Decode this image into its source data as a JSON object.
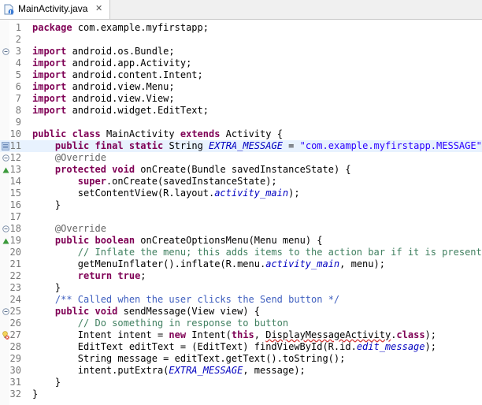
{
  "editor_tab": {
    "title": "MainActivity.java",
    "close_glyph": "✕"
  },
  "line_numbers": [
    "1",
    "2",
    "3",
    "4",
    "5",
    "6",
    "7",
    "8",
    "9",
    "10",
    "11",
    "12",
    "13",
    "14",
    "15",
    "16",
    "17",
    "18",
    "19",
    "20",
    "21",
    "22",
    "23",
    "24",
    "25",
    "26",
    "27",
    "28",
    "29",
    "30",
    "31",
    "32"
  ],
  "code": {
    "l1a": "package",
    "l1b": " com.example.myfirstapp;",
    "l3a": "import",
    "l3b": " android.os.Bundle;",
    "l4a": "import",
    "l4b": " android.app.Activity;",
    "l5a": "import",
    "l5b": " android.content.Intent;",
    "l6a": "import",
    "l6b": " android.view.Menu;",
    "l7a": "import",
    "l7b": " android.view.View;",
    "l8a": "import",
    "l8b": " android.widget.EditText;",
    "l10a": "public",
    "l10b": " ",
    "l10c": "class",
    "l10d": " MainActivity ",
    "l10e": "extends",
    "l10f": " Activity {",
    "l11a": "    ",
    "l11b": "public",
    "l11c": " ",
    "l11d": "final",
    "l11e": " ",
    "l11f": "static",
    "l11g": " String ",
    "l11h": "EXTRA_MESSAGE",
    "l11i": " = ",
    "l11j": "\"com.example.myfirstapp.MESSAGE\"",
    "l11k": ";",
    "l12a": "    ",
    "l12b": "@Override",
    "l13a": "    ",
    "l13b": "protected",
    "l13c": " ",
    "l13d": "void",
    "l13e": " onCreate(Bundle savedInstanceState) {",
    "l14a": "        ",
    "l14b": "super",
    "l14c": ".onCreate(savedInstanceState);",
    "l15a": "        setContentView(R.layout.",
    "l15b": "activity_main",
    "l15c": ");",
    "l16a": "    }",
    "l18a": "    ",
    "l18b": "@Override",
    "l19a": "    ",
    "l19b": "public",
    "l19c": " ",
    "l19d": "boolean",
    "l19e": " onCreateOptionsMenu(Menu menu) {",
    "l20a": "        ",
    "l20b": "// Inflate the menu; this adds items to the action bar if it is present.",
    "l21a": "        getMenuInflater().inflate(R.menu.",
    "l21b": "activity_main",
    "l21c": ", menu);",
    "l22a": "        ",
    "l22b": "return",
    "l22c": " ",
    "l22d": "true",
    "l22e": ";",
    "l23a": "    }",
    "l24a": "    ",
    "l24b": "/** Called when the user clicks the Send button */",
    "l25a": "    ",
    "l25b": "public",
    "l25c": " ",
    "l25d": "void",
    "l25e": " sendMessage(View view) {",
    "l26a": "        ",
    "l26b": "// Do something in response to button",
    "l27a": "        Intent intent = ",
    "l27b": "new",
    "l27c": " Intent(",
    "l27d": "this",
    "l27e": ", ",
    "l27f": "DisplayMessageActivity",
    "l27g": ".",
    "l27h": "class",
    "l27i": ");",
    "l28a": "        EditText editText = (EditText) findViewById(R.id.",
    "l28b": "edit_message",
    "l28c": ");",
    "l29a": "        String message = editText.getText().toString();",
    "l30a": "        intent.putExtra(",
    "l30b": "EXTRA_MESSAGE",
    "l30c": ", message);",
    "l31a": "    }",
    "l32a": "}"
  },
  "colors": {
    "keyword": "#7f0055",
    "comment": "#3f7f5f",
    "javadoc": "#3f5fbf",
    "string": "#2a00ff",
    "field": "#0000c0",
    "annotation": "#646464",
    "current_line": "#e8f2fe",
    "error": "#d03030"
  }
}
